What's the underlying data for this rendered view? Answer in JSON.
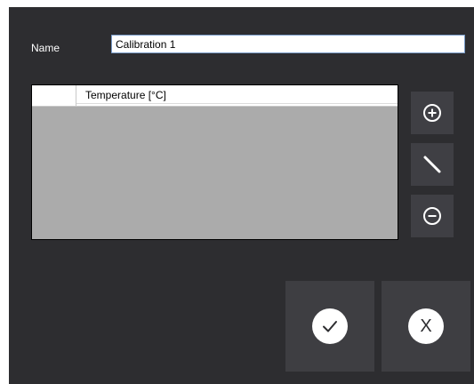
{
  "form": {
    "name_label": "Name",
    "name_value": "Calibration 1"
  },
  "table": {
    "columns": [
      "Temperature [°C]"
    ],
    "rows": []
  },
  "side_buttons": {
    "add_icon": "plus-circle-icon",
    "edit_icon": "pencil-slash-icon",
    "remove_icon": "minus-circle-icon"
  },
  "actions": {
    "confirm_icon": "checkmark-icon",
    "cancel_icon": "x-icon",
    "cancel_glyph": "X"
  },
  "colors": {
    "background": "#2d2d30",
    "button": "#3e3e42",
    "grid_empty": "#ababab"
  }
}
